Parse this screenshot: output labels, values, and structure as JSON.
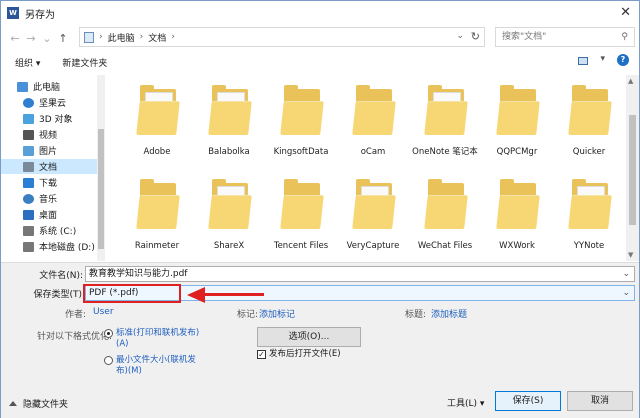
{
  "window": {
    "title": "另存为",
    "close": "✕"
  },
  "nav": {
    "back": "←",
    "forward": "→",
    "recent": "⌄",
    "up": "↑",
    "breadcrumb": [
      "此电脑",
      "文档"
    ],
    "search_placeholder": "搜索\"文档\""
  },
  "toolbar": {
    "organize": "组织 ▾",
    "new_folder": "新建文件夹",
    "view": "▾",
    "help": "?"
  },
  "sidebar": {
    "items": [
      {
        "label": "此电脑",
        "icon": "computer-icon",
        "color": "#4a90d9"
      },
      {
        "label": "坚果云",
        "icon": "cloud-icon",
        "color": "#2f7fd0"
      },
      {
        "label": "3D 对象",
        "icon": "cube-icon",
        "color": "#4aa3df"
      },
      {
        "label": "视频",
        "icon": "video-icon",
        "color": "#555555"
      },
      {
        "label": "图片",
        "icon": "picture-icon",
        "color": "#5aa0d8"
      },
      {
        "label": "文档",
        "icon": "document-icon",
        "color": "#7a8a9a",
        "selected": true
      },
      {
        "label": "下载",
        "icon": "download-icon",
        "color": "#2a7fd4"
      },
      {
        "label": "音乐",
        "icon": "music-icon",
        "color": "#3a7fc0"
      },
      {
        "label": "桌面",
        "icon": "desktop-icon",
        "color": "#2a6fc0"
      },
      {
        "label": "系统 (C:)",
        "icon": "drive-icon",
        "color": "#777777"
      },
      {
        "label": "本地磁盘 (D:)",
        "icon": "drive-icon",
        "color": "#777777"
      }
    ]
  },
  "files": {
    "row1": [
      "Adobe",
      "Balabolka",
      "KingsoftData",
      "oCam",
      "OneNote 笔记本",
      "QQPCMgr",
      "Quicker"
    ],
    "row2": [
      "Rainmeter",
      "ShareX",
      "Tencent Files",
      "VeryCapture",
      "WeChat Files",
      "WXWork",
      "YYNote"
    ]
  },
  "form": {
    "filename_label": "文件名(N):",
    "filename_value": "教育教学知识与能力.pdf",
    "savetype_label": "保存类型(T):",
    "savetype_value": "PDF (*.pdf)",
    "author_label": "作者:",
    "author_value": "User",
    "tags_label": "标记:",
    "tags_link": "添加标记",
    "title_label": "标题:",
    "title_link": "添加标题",
    "optimize_label": "针对以下格式优化:",
    "opt_standard": "标准(打印和联机发布)(A)",
    "opt_min": "最小文件大小(联机发布)(M)",
    "options_button": "选项(O)...",
    "open_after": "发布后打开文件(E)",
    "hide_folders": "隐藏文件夹",
    "tools": "工具(L)",
    "save": "保存(S)",
    "cancel": "取消"
  },
  "colors": {
    "accent": "#0078d7",
    "annotation": "#e02020",
    "folder": "#f7d774"
  }
}
